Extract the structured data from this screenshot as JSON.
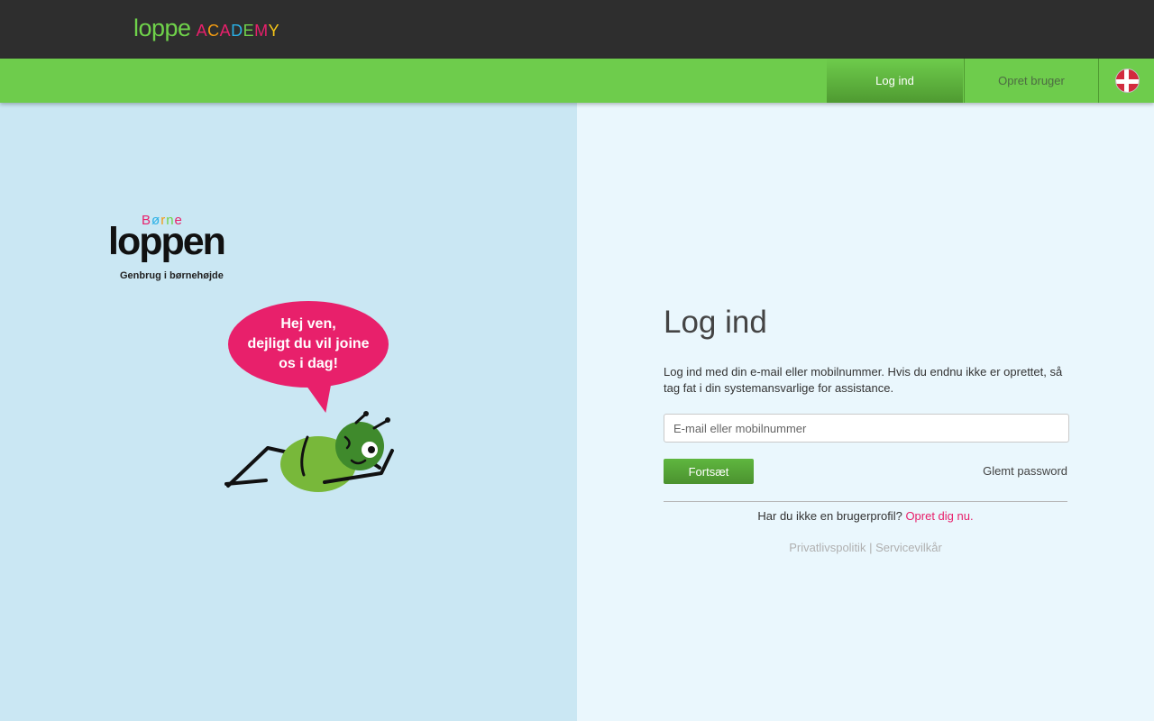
{
  "header": {
    "brand_main": "loppe",
    "brand_sub_letters": [
      {
        "ch": "A",
        "color": "#e8206b"
      },
      {
        "ch": "C",
        "color": "#f39c12"
      },
      {
        "ch": "A",
        "color": "#e8206b"
      },
      {
        "ch": "D",
        "color": "#2ab0e6"
      },
      {
        "ch": "E",
        "color": "#6fd24a"
      },
      {
        "ch": "M",
        "color": "#e8206b"
      },
      {
        "ch": "Y",
        "color": "#f5c518"
      }
    ]
  },
  "nav": {
    "login_label": "Log ind",
    "register_label": "Opret bruger",
    "language_icon": "denmark-flag-icon"
  },
  "promo": {
    "logo_top": "Børne",
    "logo_main": "loppen",
    "logo_tagline": "Genbrug i børnehøjde",
    "bubble_lines": [
      "Hej ven,",
      "dejligt du vil joine",
      "os i dag!"
    ]
  },
  "login": {
    "title": "Log ind",
    "description": "Log ind med din e-mail eller mobilnummer. Hvis du endnu ikke er oprettet, så tag fat i din systemansvarlige for assistance.",
    "email_placeholder": "E-mail eller mobilnummer",
    "continue_label": "Fortsæt",
    "forgot_label": "Glemt password",
    "signup_prompt": "Har du ikke en brugerprofil?",
    "signup_link": "Opret dig nu.",
    "privacy_label": "Privatlivspolitik",
    "separator": "|",
    "terms_label": "Servicevilkår"
  },
  "colors": {
    "accent_green": "#6ecc4c",
    "pink": "#e8206b",
    "topbar": "#2e2e2e"
  }
}
